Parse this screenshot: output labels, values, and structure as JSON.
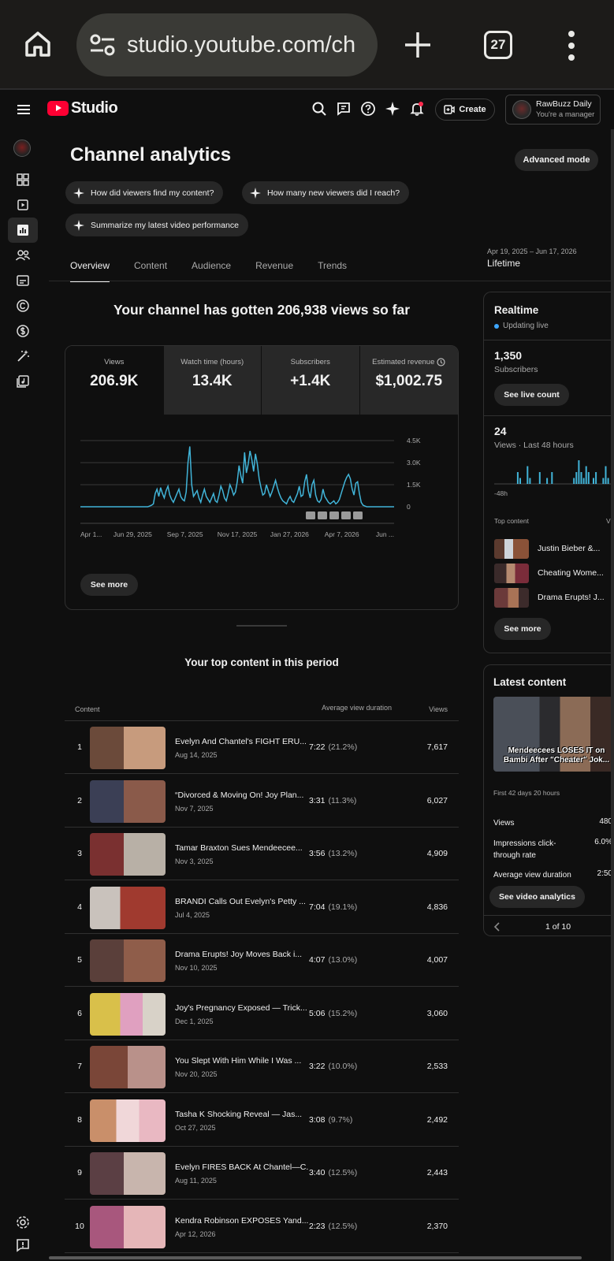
{
  "browser": {
    "url": "studio.youtube.com/ch",
    "tab_count": "27"
  },
  "header": {
    "logo_text": "Studio",
    "create_label": "Create",
    "account_name": "RawBuzz Daily",
    "account_role": "You're a manager"
  },
  "page": {
    "title": "Channel analytics",
    "advanced_mode": "Advanced mode",
    "chips": [
      "How did viewers find my content?",
      "How many new viewers did I reach?",
      "Summarize my latest video performance"
    ],
    "tabs": [
      "Overview",
      "Content",
      "Audience",
      "Revenue",
      "Trends"
    ],
    "date_range": "Apr 19, 2025 – Jun 17, 2026",
    "date_label": "Lifetime",
    "headline": "Your channel has gotten 206,938 views so far"
  },
  "metrics": [
    {
      "label": "Views",
      "value": "206.9K"
    },
    {
      "label": "Watch time (hours)",
      "value": "13.4K"
    },
    {
      "label": "Subscribers",
      "value": "+1.4K"
    },
    {
      "label": "Estimated revenue",
      "value": "$1,002.75"
    }
  ],
  "chart_data": {
    "type": "line",
    "series": [
      {
        "values": [
          0,
          0,
          0,
          0,
          0,
          0,
          0,
          0,
          0,
          0,
          0,
          0,
          0,
          0,
          0,
          0,
          0,
          0,
          0,
          0,
          0,
          0,
          0,
          0,
          0,
          0,
          0,
          0,
          0,
          0,
          0,
          0,
          0,
          0,
          0,
          0,
          0,
          0,
          50,
          100,
          200,
          900,
          1200,
          700,
          1300,
          900,
          600,
          1100,
          1400,
          800,
          500,
          300,
          600,
          900,
          1200,
          700,
          500,
          400,
          1000,
          3000,
          4100,
          1500,
          700,
          900,
          1100,
          600,
          300,
          800,
          1200,
          700,
          500,
          300,
          600,
          900,
          400,
          300,
          800,
          1400,
          1100,
          600,
          400,
          900,
          1500,
          1200,
          800,
          1000,
          1700,
          2800,
          2100,
          1600,
          3700,
          2300,
          2900,
          3800,
          3200,
          2400,
          3600,
          2900,
          1900,
          1300,
          800,
          900,
          1500,
          1100,
          700,
          1000,
          1400,
          1800,
          1300,
          900,
          600,
          400,
          300,
          200,
          500,
          700,
          400,
          300,
          600,
          900,
          1400,
          700,
          800,
          1700,
          2200,
          1100,
          600,
          1500,
          1800,
          800,
          400,
          300,
          500,
          1200,
          700,
          500,
          300,
          200,
          300,
          400,
          200,
          300,
          500,
          900,
          1300,
          1700,
          2000,
          2200,
          1900,
          1200,
          800,
          1600,
          1700,
          900,
          300,
          100,
          50,
          0,
          0,
          0,
          0,
          0,
          0,
          0,
          0,
          0,
          0,
          0,
          0,
          0,
          0,
          0,
          0
        ]
      }
    ],
    "x_tick_labels": [
      "Apr 1...",
      "Jun 29, 2025",
      "Sep 7, 2025",
      "Nov 17, 2025",
      "Jan 27, 2026",
      "Apr 7, 2026",
      "Jun ..."
    ],
    "y_tick_labels": [
      "4.5K",
      "3.0K",
      "1.5K",
      "0"
    ],
    "ylim": [
      0,
      4500
    ],
    "color": "#41b4d8",
    "grid": true
  },
  "card": {
    "see_more": "See more"
  },
  "top_content": {
    "title": "Your top content in this period",
    "col_content": "Content",
    "col_avd": "Average view duration",
    "col_views": "Views",
    "rows": [
      {
        "rank": "1",
        "title": "Evelyn And Chantel's FIGHT ERU...",
        "date": "Aug 14, 2025",
        "dur": "7:22",
        "pct": "(21.2%)",
        "views": "7,617"
      },
      {
        "rank": "2",
        "title": "“Divorced & Moving On! Joy Plan...",
        "date": "Nov 7, 2025",
        "dur": "3:31",
        "pct": "(11.3%)",
        "views": "6,027"
      },
      {
        "rank": "3",
        "title": "Tamar Braxton Sues Mendeecee...",
        "date": "Nov 3, 2025",
        "dur": "3:56",
        "pct": "(13.2%)",
        "views": "4,909"
      },
      {
        "rank": "4",
        "title": "BRANDI Calls Out Evelyn's Petty ...",
        "date": "Jul 4, 2025",
        "dur": "7:04",
        "pct": "(19.1%)",
        "views": "4,836"
      },
      {
        "rank": "5",
        "title": "Drama Erupts! Joy Moves Back i...",
        "date": "Nov 10, 2025",
        "dur": "4:07",
        "pct": "(13.0%)",
        "views": "4,007"
      },
      {
        "rank": "6",
        "title": "Joy's Pregnancy Exposed — Trick...",
        "date": "Dec 1, 2025",
        "dur": "5:06",
        "pct": "(15.2%)",
        "views": "3,060"
      },
      {
        "rank": "7",
        "title": "You Slept With Him While I Was ...",
        "date": "Nov 20, 2025",
        "dur": "3:22",
        "pct": "(10.0%)",
        "views": "2,533"
      },
      {
        "rank": "8",
        "title": "Tasha K Shocking Reveal — Jas...",
        "date": "Oct 27, 2025",
        "dur": "3:08",
        "pct": "(9.7%)",
        "views": "2,492"
      },
      {
        "rank": "9",
        "title": "Evelyn FIRES BACK At Chantel—C...",
        "date": "Aug 11, 2025",
        "dur": "3:40",
        "pct": "(12.5%)",
        "views": "2,443"
      },
      {
        "rank": "10",
        "title": "Kendra Robinson EXPOSES Yand...",
        "date": "Apr 12, 2026",
        "dur": "2:23",
        "pct": "(12.5%)",
        "views": "2,370"
      }
    ]
  },
  "realtime": {
    "title": "Realtime",
    "status": "Updating live",
    "subs_value": "1,350",
    "subs_label": "Subscribers",
    "live_count_btn": "See live count",
    "views_value": "24",
    "views_label": "Views · Last 48 hours",
    "axis_start": "-48h",
    "bars": [
      0,
      0,
      0,
      0,
      0,
      0,
      0,
      0,
      0,
      2,
      1,
      0,
      0,
      3,
      1,
      0,
      0,
      0,
      2,
      0,
      0,
      1,
      0,
      2,
      0,
      0,
      0,
      0,
      0,
      0,
      0,
      0,
      1,
      2,
      4,
      2,
      1,
      3,
      2,
      0,
      1,
      2,
      0,
      0,
      1,
      3,
      1,
      0,
      0
    ],
    "top_content_label": "Top content",
    "top_content_col": "V",
    "top_items": [
      "Justin Bieber &...",
      "Cheating Wome...",
      "Drama Erupts! J..."
    ],
    "see_more": "See more"
  },
  "latest": {
    "title": "Latest content",
    "thumb_caption_1": "Mendeecees LOSES IT on",
    "thumb_caption_2": "Bambi After \"Cheater\" Jok...",
    "first_period": "First 42 days 20 hours",
    "stats": [
      {
        "label": "Views",
        "value": "480"
      },
      {
        "label": "Impressions click-through rate",
        "value": "6.0%"
      },
      {
        "label": "Average view duration",
        "value": "2:50"
      }
    ],
    "analytics_btn": "See video analytics",
    "pager": "1 of 10"
  }
}
